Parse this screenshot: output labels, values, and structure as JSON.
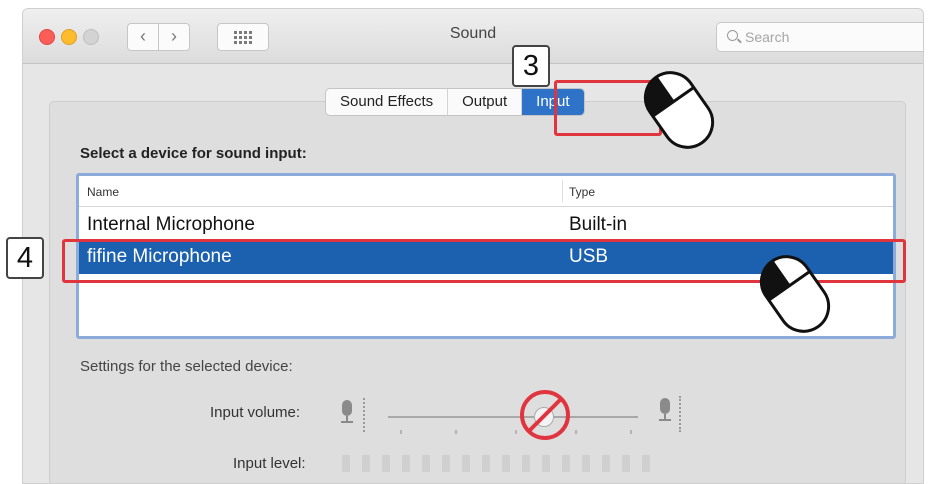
{
  "window": {
    "title": "Sound",
    "search_placeholder": "Search",
    "nav_back": "‹",
    "nav_forward": "›"
  },
  "tabs": [
    {
      "label": "Sound Effects",
      "selected": false
    },
    {
      "label": "Output",
      "selected": false
    },
    {
      "label": "Input",
      "selected": true
    }
  ],
  "device_section": {
    "heading": "Select a device for sound input:",
    "columns": [
      "Name",
      "Type"
    ],
    "rows": [
      {
        "name": "Internal Microphone",
        "type": "Built-in",
        "selected": false
      },
      {
        "name": "fifine Microphone",
        "type": "USB",
        "selected": true
      }
    ]
  },
  "settings": {
    "heading": "Settings for the selected device:",
    "input_volume_label": "Input volume:",
    "input_level_label": "Input level:"
  },
  "annotations": {
    "step3": "3",
    "step4": "4"
  },
  "colors": {
    "selection_blue": "#1b61b0",
    "tab_selected_blue": "#2f73c9",
    "highlight_red": "#e0353f",
    "table_border": "#8cabdb"
  },
  "icons": [
    "search-icon",
    "microphone-low-icon",
    "microphone-high-icon",
    "prohibited-icon",
    "mouse-click-icon",
    "app-grid-icon"
  ]
}
